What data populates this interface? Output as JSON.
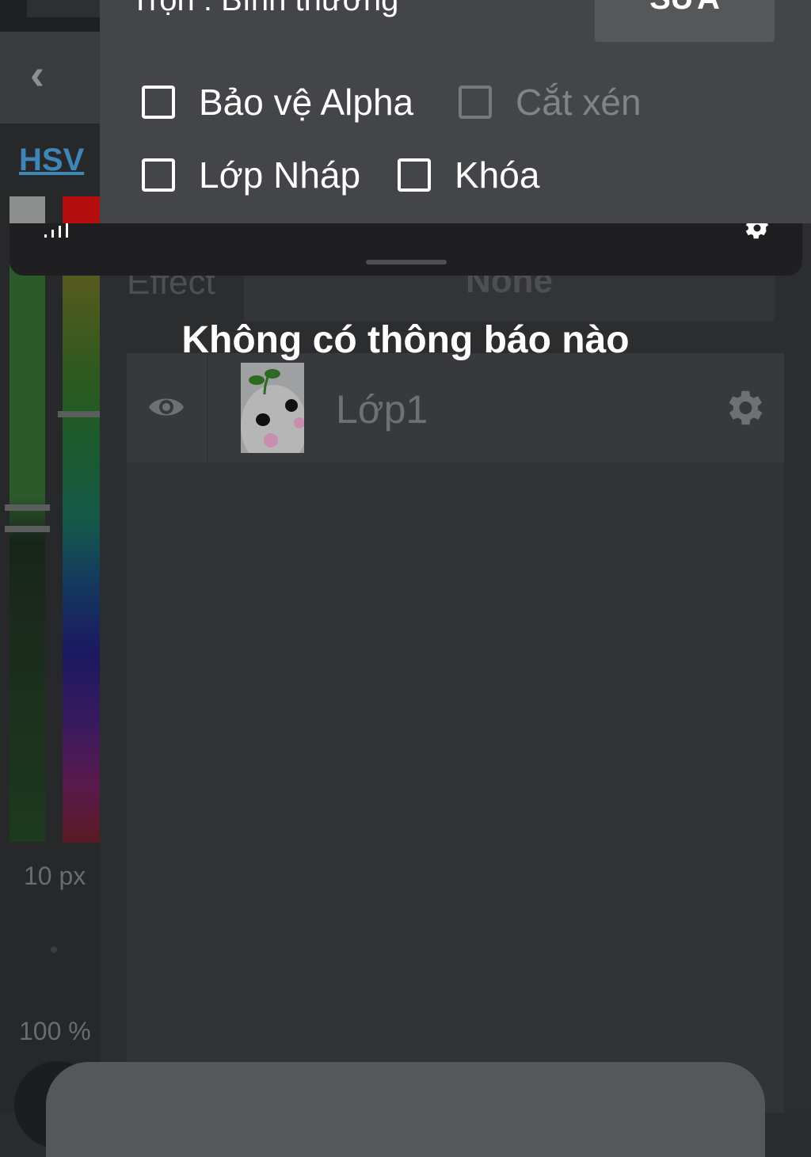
{
  "color_panel": {
    "mode_link": "HSV",
    "primary_color": "#8c8f8e",
    "secondary_color": "#b40e0e",
    "brush_size": "10 px",
    "opacity": "100 %"
  },
  "layer_panel": {
    "blend_mode": "Trộn : Bình thường",
    "edit_button": "SỬA",
    "options": {
      "protect_alpha": "Bảo vệ Alpha",
      "clipping": "Cắt xén",
      "draft_layer": "Lớp Nháp",
      "lock": "Khóa"
    },
    "effect_label": "Effect",
    "effect_value": "None",
    "layers": [
      {
        "name": "Lớp1",
        "visible": true
      }
    ]
  },
  "notification_shade": {
    "empty_message": "Không có thông báo nào"
  },
  "icons": {
    "back": "chevron-left-icon",
    "visibility": "eye-icon",
    "layer_settings": "gear-icon",
    "signal": "signal-icon",
    "quick_settings": "gear-icon"
  }
}
